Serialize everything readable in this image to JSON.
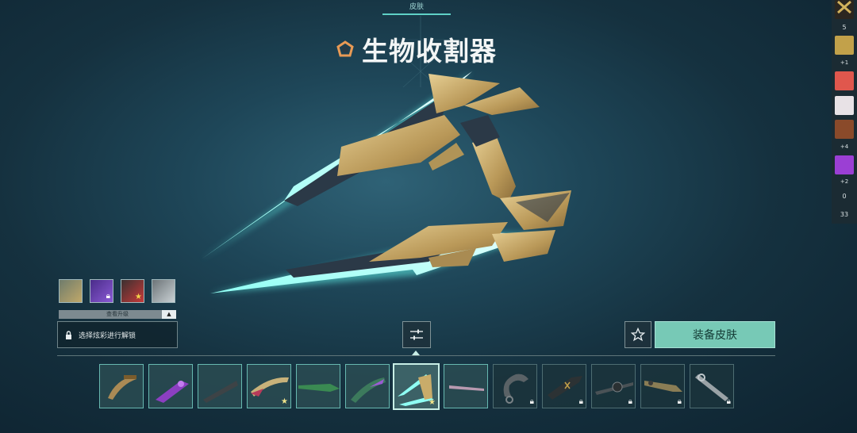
{
  "header": {
    "tab_label": "皮肤",
    "skin_name": "生物收割器"
  },
  "rail": {
    "items": [
      {
        "type": "agent",
        "icon": "x-agent-icon"
      },
      {
        "type": "count",
        "text": "5"
      },
      {
        "type": "agent",
        "icon": "gold-agent-icon"
      },
      {
        "type": "party",
        "text": "+1"
      },
      {
        "type": "agent",
        "icon": "red-hair-agent-icon"
      },
      {
        "type": "agent",
        "icon": "white-hair-agent-icon"
      },
      {
        "type": "agent",
        "icon": "orange-agent-icon"
      },
      {
        "type": "party",
        "text": "+4"
      },
      {
        "type": "agent",
        "icon": "purple-agent-icon"
      },
      {
        "type": "party",
        "text": "+2"
      },
      {
        "type": "count",
        "text": "0"
      },
      {
        "type": "count",
        "text": "33"
      }
    ]
  },
  "chromas": [
    {
      "name": "chroma-base",
      "color": "#8c8a5c",
      "locked": false,
      "new": false
    },
    {
      "name": "chroma-purple",
      "color": "#7b3ec9",
      "locked": true,
      "new": false
    },
    {
      "name": "chroma-red",
      "color": "#c63a3a",
      "locked": false,
      "new": true
    },
    {
      "name": "chroma-silver",
      "color": "#b7c0c4",
      "locked": false,
      "new": false
    }
  ],
  "upgrades": {
    "view_label": "查看升级",
    "unlock_text": "选择炫彩进行解锁"
  },
  "actions": {
    "equip_label": "装备皮肤"
  },
  "skins": [
    {
      "state": "owned",
      "badge": ""
    },
    {
      "state": "owned",
      "badge": ""
    },
    {
      "state": "owned",
      "badge": ""
    },
    {
      "state": "owned",
      "badge": "★"
    },
    {
      "state": "owned",
      "badge": ""
    },
    {
      "state": "owned",
      "badge": ""
    },
    {
      "state": "selected",
      "badge": "★"
    },
    {
      "state": "owned",
      "badge": ""
    },
    {
      "state": "locked",
      "badge": ""
    },
    {
      "state": "locked",
      "badge": ""
    },
    {
      "state": "locked",
      "badge": ""
    },
    {
      "state": "locked",
      "badge": ""
    },
    {
      "state": "locked",
      "badge": ""
    }
  ],
  "colors": {
    "accent": "#77c9b6",
    "cyan_glow": "#5ef0e6",
    "gold": "#c9ac6a"
  }
}
